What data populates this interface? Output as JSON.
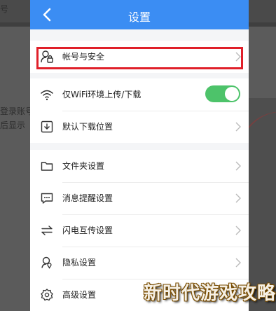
{
  "header": {
    "title": "设置",
    "back_icon": "chevron-left-icon"
  },
  "background": {
    "text_line1": "登录账号",
    "text_line2": "后显示",
    "top_text": "号"
  },
  "sections": [
    {
      "items": [
        {
          "label": "帐号与安全",
          "icon": "account-lock-icon",
          "highlighted": true
        }
      ]
    },
    {
      "items": [
        {
          "label": "仅WiFi环境上传/下载",
          "icon": "wifi-icon",
          "toggle": true,
          "toggle_on": true
        },
        {
          "label": "默认下载位置",
          "icon": "download-icon"
        }
      ]
    },
    {
      "items": [
        {
          "label": "文件夹设置",
          "icon": "folder-icon"
        },
        {
          "label": "消息提醒设置",
          "icon": "message-icon"
        },
        {
          "label": "闪电互传设置",
          "icon": "transfer-icon"
        },
        {
          "label": "隐私设置",
          "icon": "privacy-icon"
        },
        {
          "label": "高级设置",
          "icon": "gear-icon"
        }
      ]
    }
  ],
  "watermark": "新时代游戏攻略",
  "colors": {
    "header": "#3b8df3",
    "toggle_on": "#4dc36a",
    "highlight": "#e0202a"
  }
}
